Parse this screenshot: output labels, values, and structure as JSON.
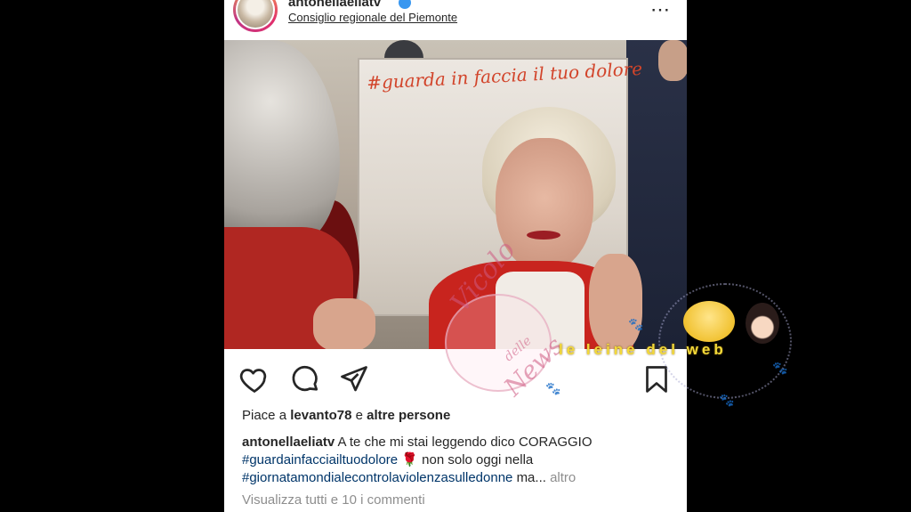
{
  "post": {
    "username": "antonellaeliatv",
    "location": "Consiglio regionale del Piemonte",
    "more_icon": "⋯"
  },
  "photo": {
    "mirror_text": "#guarda in faccia il tuo dolore"
  },
  "actions": {
    "like_icon": "heart-icon",
    "comment_icon": "comment-icon",
    "share_icon": "paper-plane-icon",
    "save_icon": "bookmark-icon"
  },
  "likes": {
    "prefix": "Piace a",
    "user": "levanto78",
    "connector": "e",
    "others": "altre persone"
  },
  "caption": {
    "user": "antonellaeliatv",
    "text": "A te che mi stai leggendo dico CORAGGIO",
    "hashtag1": "#guardainfacciailtuodolore",
    "emoji": "🌹",
    "text2": "non solo oggi nella",
    "hashtag2": "#giornatamondialecontrolaviolenzasulledonne",
    "ellipsis": "ma...",
    "more": "altro"
  },
  "comments": {
    "view_all": "Visualizza tutti e 10 i commenti"
  },
  "watermark": {
    "title": "Vicolo",
    "middle": "delle",
    "sub": "News",
    "label": "le leine del web"
  }
}
